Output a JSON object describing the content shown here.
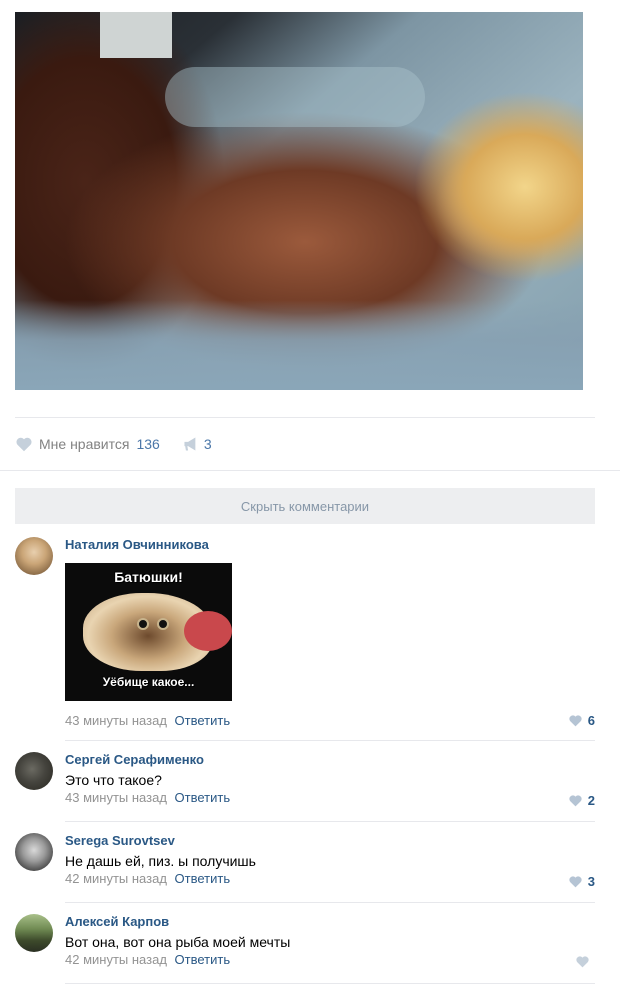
{
  "post": {
    "likes_label": "Мне нравится",
    "likes_count": "136",
    "shares_count": "3"
  },
  "hide_comments_label": "Скрыть комментарии",
  "comments": [
    {
      "author": "Наталия Овчинникова",
      "meme_top": "Батюшки!",
      "meme_bottom": "Уёбище какое...",
      "time": "43 минуты назад",
      "reply": "Ответить",
      "likes": "6"
    },
    {
      "author": "Сергей Серафименко",
      "text": "Это что такое?",
      "time": "43 минуты назад",
      "reply": "Ответить",
      "likes": "2"
    },
    {
      "author": "Serega Surovtsev",
      "text": "Не дашь ей, пиз. ы получишь",
      "time": "42 минуты назад",
      "reply": "Ответить",
      "likes": "3"
    },
    {
      "author": "Алексей Карпов",
      "text": "Вот она, вот она рыба моей мечты",
      "time": "42 минуты назад",
      "reply": "Ответить",
      "likes": ""
    }
  ],
  "colors": {
    "link": "#2a5885",
    "accent": "#4a76a8",
    "muted": "#939393",
    "button_bg": "#edeef0"
  }
}
